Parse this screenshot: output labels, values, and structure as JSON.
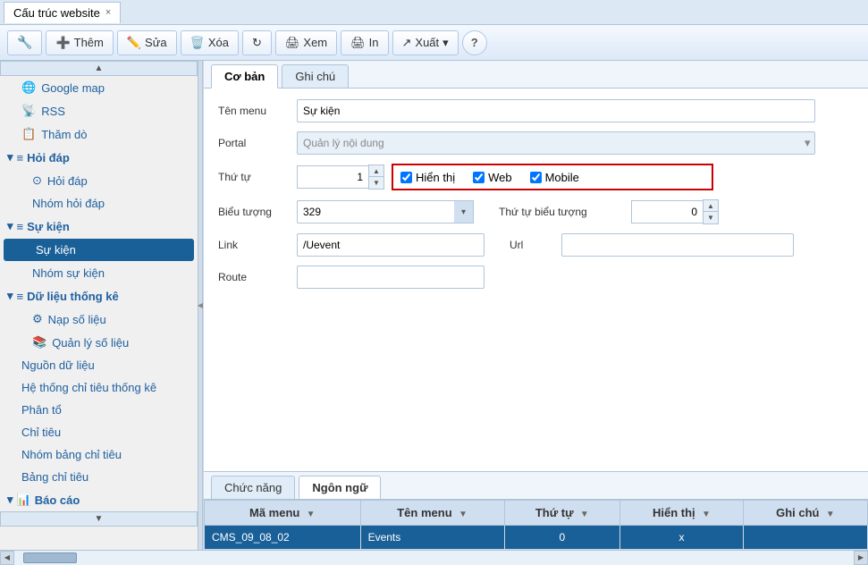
{
  "tab": {
    "title": "Cấu trúc website",
    "close_label": "×"
  },
  "toolbar": {
    "logo_icon": "⊞",
    "add_label": "Thêm",
    "edit_label": "Sửa",
    "delete_label": "Xóa",
    "refresh_icon": "↻",
    "view_label": "Xem",
    "print_label": "In",
    "export_label": "Xuất",
    "export_arrow": "▾",
    "help_label": "?"
  },
  "sidebar": {
    "items": [
      {
        "label": "Google map",
        "icon": "🌐",
        "indent": 1
      },
      {
        "label": "RSS",
        "icon": "📡",
        "indent": 1
      },
      {
        "label": "Thăm dò",
        "icon": "📋",
        "indent": 1
      },
      {
        "label": "Hỏi đáp",
        "icon": "≡",
        "indent": 0,
        "group": true
      },
      {
        "label": "Hỏi đáp",
        "icon": "⊙",
        "indent": 2
      },
      {
        "label": "Nhóm hỏi đáp",
        "icon": "",
        "indent": 2
      },
      {
        "label": "Sự kiện",
        "icon": "≡",
        "indent": 0,
        "group": true
      },
      {
        "label": "Sự kiện",
        "icon": "",
        "indent": 2,
        "active": true
      },
      {
        "label": "Nhóm sự kiện",
        "icon": "",
        "indent": 2
      },
      {
        "label": "Dữ liệu thống kê",
        "icon": "≡",
        "indent": 0,
        "group": true
      },
      {
        "label": "Nạp số liệu",
        "icon": "⚙",
        "indent": 2
      },
      {
        "label": "Quản lý số liệu",
        "icon": "📚",
        "indent": 2
      },
      {
        "label": "Nguồn dữ liệu",
        "icon": "",
        "indent": 1
      },
      {
        "label": "Hệ thống chỉ tiêu thống kê",
        "icon": "",
        "indent": 1
      },
      {
        "label": "Phân tổ",
        "icon": "",
        "indent": 1
      },
      {
        "label": "Chỉ tiêu",
        "icon": "",
        "indent": 1
      },
      {
        "label": "Nhóm bảng chỉ tiêu",
        "icon": "",
        "indent": 1
      },
      {
        "label": "Bảng chỉ tiêu",
        "icon": "",
        "indent": 1
      },
      {
        "label": "Báo cáo",
        "icon": "📊",
        "indent": 0,
        "group": true
      }
    ]
  },
  "content": {
    "tabs": [
      "Cơ bản",
      "Ghi chú"
    ],
    "active_tab": "Cơ bản",
    "form": {
      "ten_menu_label": "Tên menu",
      "ten_menu_value": "Sự kiện",
      "portal_label": "Portal",
      "portal_value": "Quản lý nội dung",
      "thu_tu_label": "Thứ tự",
      "thu_tu_value": "1",
      "hien_thi_label": "Hiển thị",
      "web_label": "Web",
      "mobile_label": "Mobile",
      "bieu_tuong_label": "Biểu tượng",
      "bieu_tuong_value": "329",
      "thu_tu_bieu_tuong_label": "Thứ tự biểu tượng",
      "thu_tu_bieu_tuong_value": "0",
      "link_label": "Link",
      "link_value": "/Uevent",
      "url_label": "Url",
      "url_value": "",
      "route_label": "Route",
      "route_value": ""
    }
  },
  "bottom": {
    "tabs": [
      "Chức năng",
      "Ngôn ngữ"
    ],
    "active_tab": "Ngôn ngữ",
    "table": {
      "columns": [
        {
          "label": "Mã menu",
          "filter": true
        },
        {
          "label": "Tên menu",
          "filter": true
        },
        {
          "label": "Thứ tự",
          "filter": true
        },
        {
          "label": "Hiển thị",
          "filter": true
        },
        {
          "label": "Ghi chú",
          "filter": true
        }
      ],
      "rows": [
        {
          "ma_menu": "CMS_09_08_02",
          "ten_menu": "Events",
          "thu_tu": "0",
          "hien_thi": "x",
          "ghi_chu": "",
          "selected": true
        }
      ]
    }
  }
}
